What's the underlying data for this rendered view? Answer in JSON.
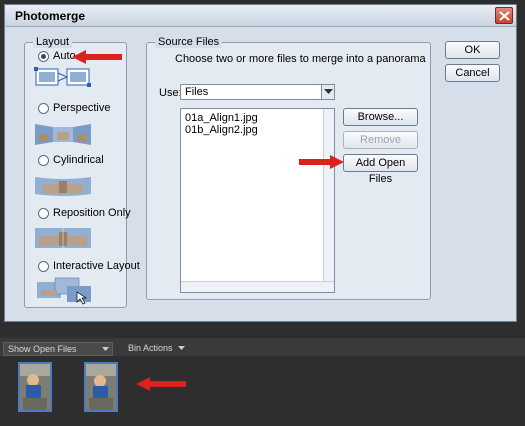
{
  "dialog": {
    "title": "Photomerge",
    "ok_label": "OK",
    "cancel_label": "Cancel"
  },
  "layout": {
    "group_label": "Layout",
    "options": [
      {
        "label": "Auto",
        "checked": true
      },
      {
        "label": "Perspective",
        "checked": false
      },
      {
        "label": "Cylindrical",
        "checked": false
      },
      {
        "label": "Reposition Only",
        "checked": false
      },
      {
        "label": "Interactive Layout",
        "checked": false
      }
    ]
  },
  "source": {
    "group_label": "Source Files",
    "instructions": "Choose two or more files to merge into a panorama",
    "use_label": "Use:",
    "use_value": "Files",
    "files": [
      "01a_Align1.jpg",
      "01b_Align2.jpg"
    ],
    "browse_label": "Browse...",
    "remove_label": "Remove",
    "add_open_files_label": "Add Open Files"
  },
  "bin": {
    "show_label": "Show Open Files",
    "actions_label": "Bin Actions"
  },
  "colors": {
    "dialog_bg": "#d6dfe9",
    "arrow": "#d9231d",
    "selection": "#4d7cc2"
  }
}
